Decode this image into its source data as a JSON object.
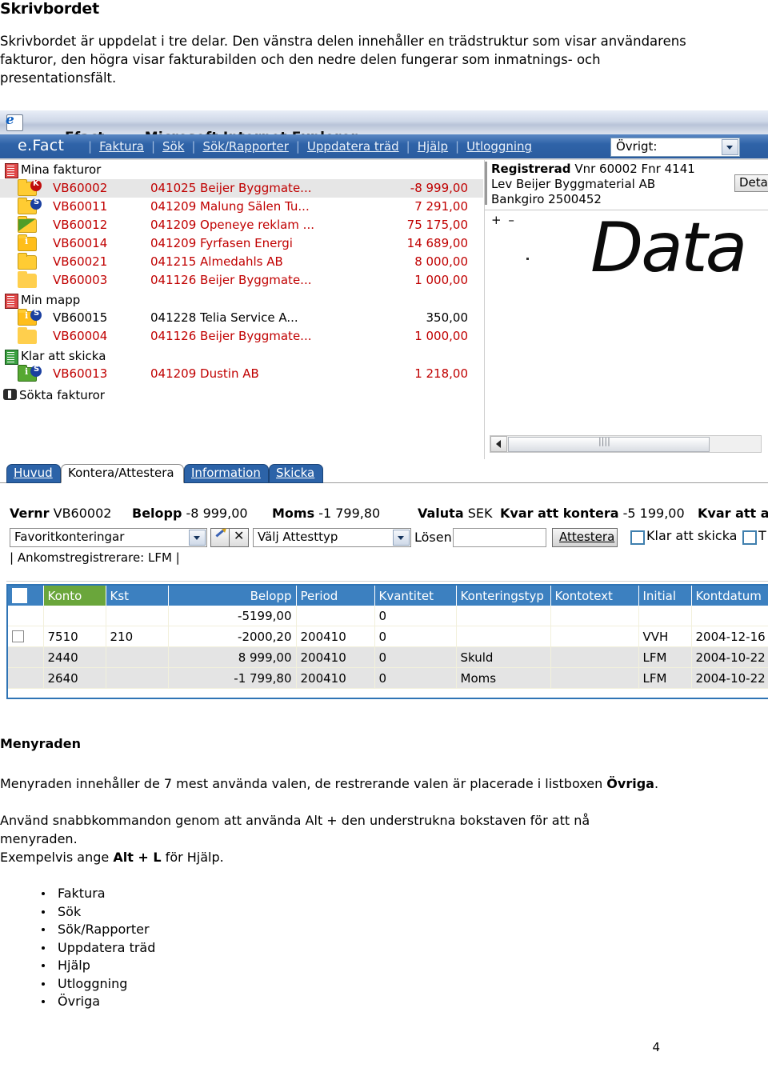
{
  "document": {
    "heading": "Skrivbordet",
    "intro": "Skrivbordet är uppdelat i tre delar. Den vänstra delen innehåller en trädstruktur som visar användarens fakturor, den högra visar fakturabilden och den nedre delen fungerar som inmatnings- och presentationsfält.",
    "section2_heading": "Menyraden",
    "section2_p1_a": "Menyraden innehåller de 7 mest använda valen, de restrerande valen är placerade i listboxen ",
    "section2_p1_b": "Övriga",
    "section2_p1_c": ".",
    "section2_p2": "Använd snabbkommandon genom att använda Alt + den understrukna bokstaven för att nå menyraden.",
    "section2_p3_a": "Exempelvis ange ",
    "section2_p3_b": "Alt + L",
    "section2_p3_c": " för Hjälp.",
    "menu_list": [
      "Faktura",
      "Sök",
      "Sök/Rapporter",
      "Uppdatera träd",
      "Hjälp",
      "Utloggning",
      "Övriga"
    ],
    "page_number": "4"
  },
  "screenshot": {
    "window": {
      "title": "Efact",
      "title_suffix": "- Microsoft Internet Explorer",
      "icon": "internet-explorer-icon"
    },
    "menubar": {
      "brand": "e.Fact",
      "items": [
        {
          "label": "Faktura",
          "accel": "k"
        },
        {
          "label": "Sök",
          "accel": "ö"
        },
        {
          "label": "Sök/Rapporter",
          "accel": "R"
        },
        {
          "label": "Uppdatera träd",
          "accel": "e"
        },
        {
          "label": "Hjälp",
          "accel": "l"
        },
        {
          "label": "Utloggning",
          "accel": "U"
        }
      ],
      "separator": "|",
      "dropdown_label": "Övrigt:"
    },
    "tree": {
      "groups": [
        {
          "label": "Mina fakturor",
          "icon": "book-red-icon",
          "rows": [
            {
              "id": "VB60002",
              "text": "041025 Beijer Byggmate...",
              "amount": "-8 999,00",
              "selected": true,
              "color": "red",
              "folder": "yellow",
              "badge": "K"
            },
            {
              "id": "VB60011",
              "text": "041209 Malung Sälen Tu...",
              "amount": "7 291,00",
              "selected": false,
              "color": "red",
              "folder": "yellow",
              "badge": "S"
            },
            {
              "id": "VB60012",
              "text": "041209 Openeye reklam ...",
              "amount": "75 175,00",
              "selected": false,
              "color": "red",
              "folder": "half-green",
              "badge": ""
            },
            {
              "id": "VB60014",
              "text": "041209 Fyrfasen Energi",
              "amount": "14 689,00",
              "selected": false,
              "color": "red",
              "folder": "info",
              "badge": ""
            },
            {
              "id": "VB60021",
              "text": "041215 Almedahls AB",
              "amount": "8 000,00",
              "selected": false,
              "color": "red",
              "folder": "yellow",
              "badge": ""
            },
            {
              "id": "VB60003",
              "text": "041126 Beijer Byggmate...",
              "amount": "1 000,00",
              "selected": false,
              "color": "red",
              "folder": "plain",
              "badge": ""
            }
          ]
        },
        {
          "label": "Min mapp",
          "icon": "book-red-icon",
          "rows": [
            {
              "id": "VB60015",
              "text": "041228 Telia Service A...",
              "amount": "350,00",
              "selected": false,
              "color": "black",
              "folder": "info",
              "badge": "S"
            },
            {
              "id": "VB60004",
              "text": "041126 Beijer Byggmate...",
              "amount": "1 000,00",
              "selected": false,
              "color": "red",
              "folder": "plain",
              "badge": ""
            }
          ]
        },
        {
          "label": "Klar att skicka",
          "icon": "book-green-icon",
          "rows": [
            {
              "id": "VB60013",
              "text": "041209 Dustin AB",
              "amount": "1 218,00",
              "selected": false,
              "color": "red",
              "folder": "green-info",
              "badge": "S"
            }
          ]
        },
        {
          "label": "Sökta fakturor",
          "icon": "binoculars-icon",
          "rows": []
        }
      ]
    },
    "image_panel": {
      "status": "Registrerad",
      "vnr_label": "Vnr",
      "vnr": "60002",
      "fnr_label": "Fnr",
      "fnr": "4141",
      "supplier_label": "Lev",
      "supplier": "Beijer Byggmaterial AB",
      "bankgiro_label": "Bankgiro",
      "bankgiro": "2500452",
      "detail_button": "Deta",
      "zoom_controls": "+ –",
      "scanned_text": "Data"
    },
    "tabs": [
      {
        "label": "Huvud",
        "active": false
      },
      {
        "label": "Kontera/Attestera",
        "active": true
      },
      {
        "label": "Information",
        "active": false
      },
      {
        "label": "Skicka",
        "active": false
      }
    ],
    "summary": [
      {
        "label": "Vernr",
        "value": "VB60002"
      },
      {
        "label": "Belopp",
        "value": "-8 999,00"
      },
      {
        "label": "Moms",
        "value": "-1 799,80"
      },
      {
        "label": "Valuta",
        "value": "SEK"
      },
      {
        "label": "Kvar att kontera",
        "value": "-5 199,00"
      },
      {
        "label": "Kvar att at",
        "value": ""
      }
    ],
    "toolbar": {
      "favorites_select": "Favoritkonteringar",
      "edit_icon": "pencil-icon",
      "delete_icon": "close-x-icon",
      "attesttyp_select": "Välj Attesttyp",
      "losen_label": "Lösen",
      "losen_value": "",
      "attestera_button": "Attestera",
      "checkbox1_label": "Klar att skicka",
      "checkbox2_label": "T",
      "ankomstregistrerare": "| Ankomstregistrerare: LFM |"
    },
    "grid": {
      "columns": [
        "",
        "Konto",
        "Kst",
        "Belopp",
        "Period",
        "Kvantitet",
        "Konteringstyp",
        "Kontotext",
        "Initial",
        "Kontdatum"
      ],
      "rows": [
        {
          "check": "",
          "konto": "",
          "kst": "",
          "belopp": "-5199,00",
          "period": "",
          "kvantitet": "0",
          "konteringstyp": "",
          "kontotext": "",
          "initial": "",
          "kontdatum": "",
          "alt": false,
          "blank": true
        },
        {
          "check": "box",
          "konto": "7510",
          "kst": "210",
          "belopp": "-2000,20",
          "period": "200410",
          "kvantitet": "0",
          "konteringstyp": "",
          "kontotext": "",
          "initial": "VVH",
          "kontdatum": "2004-12-16",
          "alt": false,
          "blank": false
        },
        {
          "check": "",
          "konto": "2440",
          "kst": "",
          "belopp": "8 999,00",
          "period": "200410",
          "kvantitet": "0",
          "konteringstyp": "Skuld",
          "kontotext": "",
          "initial": "LFM",
          "kontdatum": "2004-10-22",
          "alt": true,
          "blank": false
        },
        {
          "check": "",
          "konto": "2640",
          "kst": "",
          "belopp": "-1 799,80",
          "period": "200410",
          "kvantitet": "0",
          "konteringstyp": "Moms",
          "kontotext": "",
          "initial": "LFM",
          "kontdatum": "2004-10-22",
          "alt": true,
          "blank": false
        }
      ]
    },
    "colors": {
      "menubar": "#2f63a8",
      "grid_header": "#3c80c0",
      "grid_header_accent": "#6aa63b",
      "tree_red": "#c00000",
      "folder_yellow": "#ffcc33"
    }
  }
}
